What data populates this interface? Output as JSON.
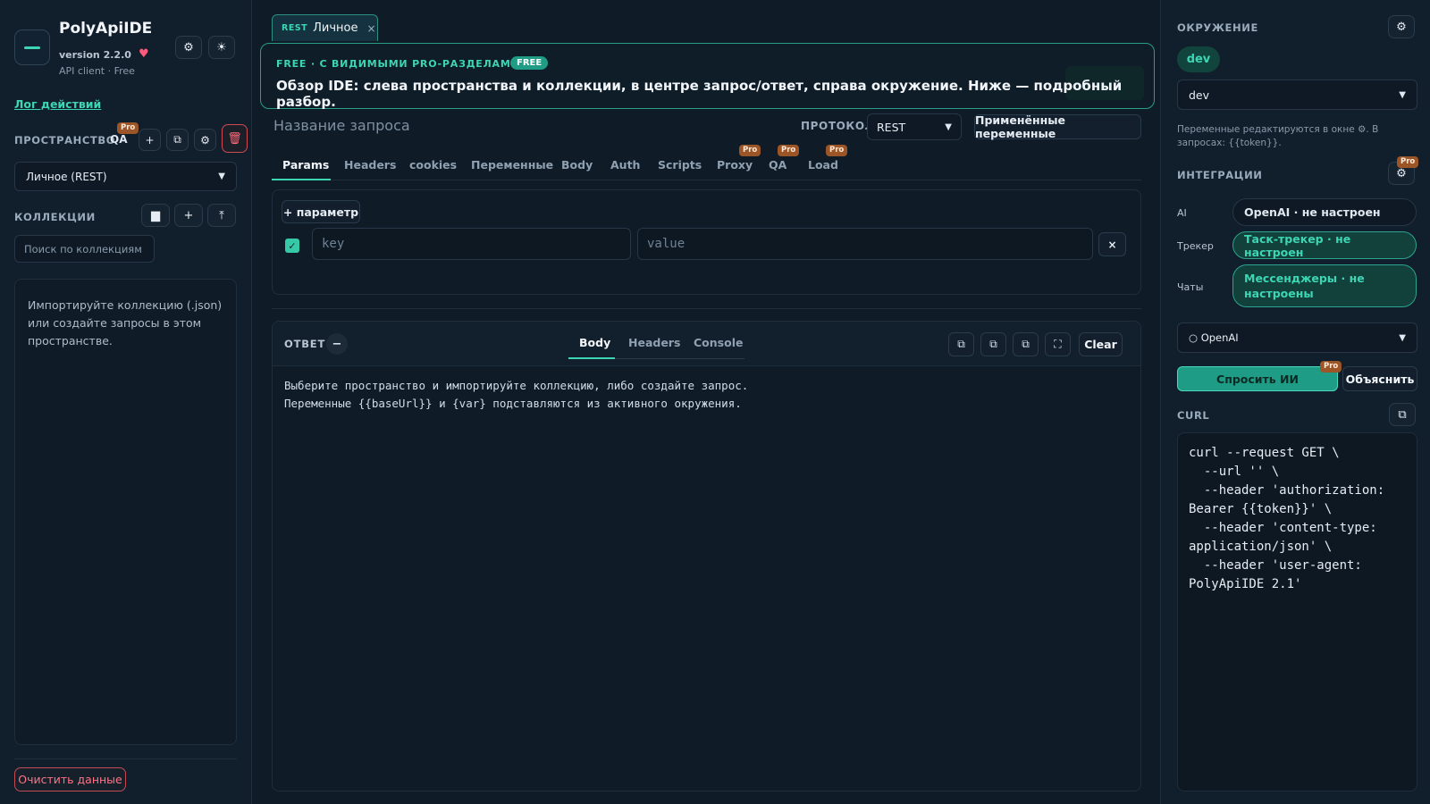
{
  "app": {
    "title": "PolyApiIDE",
    "version": "version 2.2.0",
    "subtitle": "API client · Free",
    "settings_icon": "⚙",
    "theme_icon": "☀",
    "heart_icon": "♥"
  },
  "sidebar": {
    "log_link": "Лог действий",
    "spaces_heading": "ПРОСТРАНСТВО",
    "space_qa_label": "QA",
    "pro_label": "Pro",
    "add_icon": "+",
    "copy_icon": "⧉",
    "gear_icon": "⚙",
    "trash_icon": "🗑",
    "space_select": "Личное (REST)",
    "collections_heading": "КОЛЛЕКЦИИ",
    "folder_icon": "▆",
    "import_icon": "⤒",
    "search_placeholder": "Поиск по коллекциям",
    "empty_text": "Импортируйте коллекцию (.json) или создайте запросы в этом пространстве.",
    "clear_data_label": "Очистить данные"
  },
  "request_tab": {
    "protocol": "REST",
    "name": "Личное",
    "close_icon": "×"
  },
  "banner": {
    "kicker": "FREE · С ВИДИМЫМИ PRO-РАЗДЕЛАМИ",
    "badge": "FREE",
    "text": "Обзор IDE: слева пространства и коллекции, в центре запрос/ответ, справа окружение. Ниже — подробный разбор."
  },
  "request": {
    "name_placeholder": "Название запроса",
    "protocol_label": "ПРОТОКОЛ",
    "protocol_value": "REST",
    "vars_button": "Применённые переменные",
    "tabs": [
      "Params",
      "Headers",
      "cookies",
      "Переменные",
      "Body",
      "Auth",
      "Scripts",
      "Proxy",
      "QA",
      "Load"
    ],
    "pro_label": "Pro",
    "add_param": "+ параметр",
    "key_placeholder": "key",
    "value_placeholder": "value",
    "row_checked_icon": "✓",
    "row_remove_icon": "×"
  },
  "response": {
    "title": "ОТВЕТ",
    "collapse_icon": "−",
    "tabs": [
      "Body",
      "Headers",
      "Console"
    ],
    "copy_icon": "⧉",
    "expand_icon": "⛶",
    "clear_label": "Clear",
    "body_text": "Выберите пространство и импортируйте коллекцию, либо создайте запрос.\nПеременные {{baseUrl}} и {var} подставляются из активного окружения."
  },
  "environment": {
    "heading": "ОКРУЖЕНИЕ",
    "gear_icon": "⚙",
    "active_chip": "dev",
    "select_value": "dev",
    "note": "Переменные редактируются в окне ⚙. В запросах: {{token}}."
  },
  "integrations": {
    "heading": "ИНТЕГРАЦИИ",
    "pro_label": "Pro",
    "gear_icon": "⚙",
    "items": [
      {
        "label": "AI",
        "value": "OpenAI · не настроен"
      },
      {
        "label": "Трекер",
        "value": "Таск-трекер · не настроен"
      },
      {
        "label": "Чаты",
        "value": "Мессенджеры · не настроены"
      }
    ],
    "ai_select": "○ OpenAI",
    "ask_button": "Спросить ИИ",
    "explain_button": "Объяснить"
  },
  "curl": {
    "heading": "CURL",
    "copy_icon": "⧉",
    "text": "curl --request GET \\\n  --url '' \\\n  --header 'authorization: Bearer {{token}}' \\\n  --header 'content-type: application/json' \\\n  --header 'user-agent: PolyApiIDE 2.1'"
  },
  "colors": {
    "accent": "#3dd6b5",
    "background": "#0f1b27",
    "danger": "#ff6b7a",
    "pro_badge": "#9c5527"
  }
}
